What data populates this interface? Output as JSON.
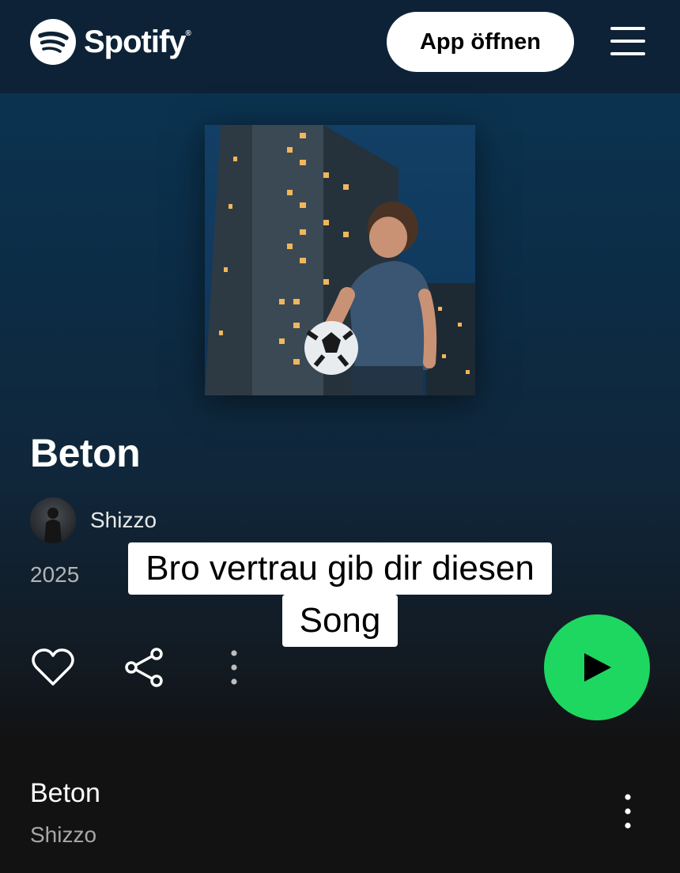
{
  "header": {
    "brand": "Spotify",
    "brand_reg": "®",
    "open_app_label": "App öffnen"
  },
  "release": {
    "title": "Beton",
    "artist": "Shizzo",
    "year": "2025"
  },
  "caption": {
    "line1": "Bro vertrau gib dir diesen",
    "line2": "Song"
  },
  "actions": {
    "like_icon": "heart-outline-icon",
    "share_icon": "share-icon",
    "more_icon": "more-vertical-icon",
    "play_icon": "play-icon"
  },
  "tracklist": [
    {
      "title": "Beton",
      "artist": "Shizzo"
    }
  ],
  "colors": {
    "accent": "#1ed760",
    "header_bg": "#0d2236",
    "hero_top": "#0b3350",
    "page_bg": "#121212"
  }
}
